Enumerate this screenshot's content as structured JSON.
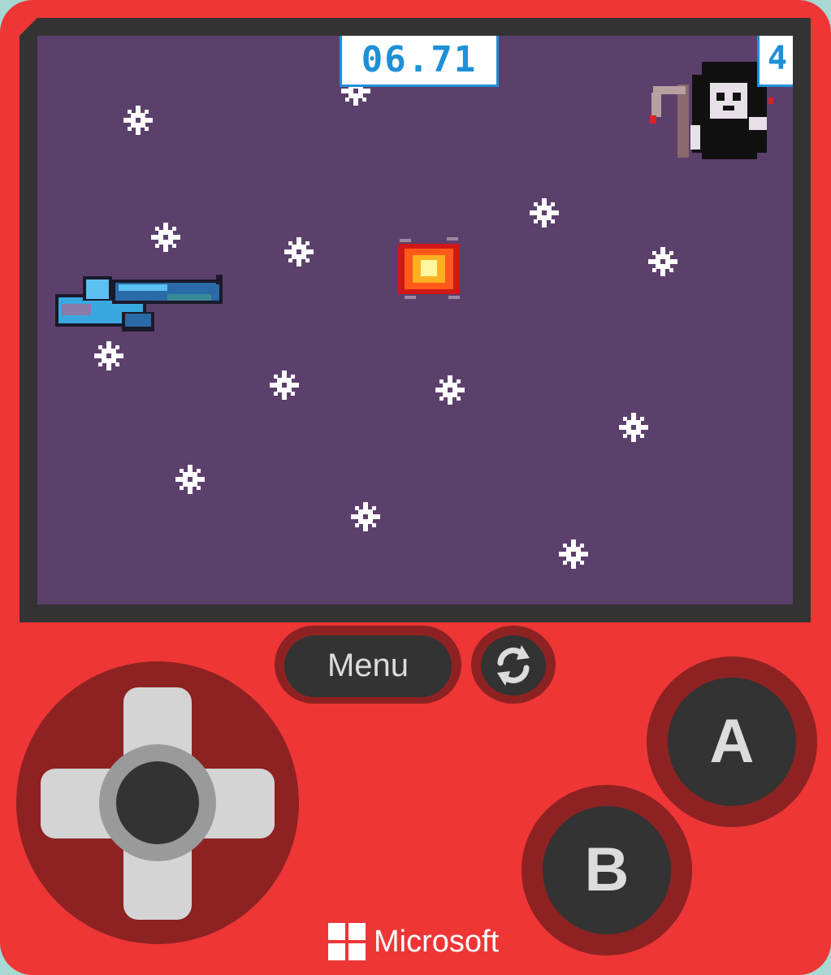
{
  "game": {
    "hud": {
      "timer": "06.71",
      "lives": "4"
    },
    "sprites": [
      "revolver",
      "fireball",
      "grim-reaper"
    ],
    "colors": {
      "screen_bg": "#5c406c",
      "hud_accent": "#1e90d8",
      "device_body": "#ee3636",
      "button_ring": "#8e2222",
      "button_face": "#333333"
    }
  },
  "controls": {
    "menu_label": "Menu",
    "reset_icon": "refresh-icon",
    "a_label": "A",
    "b_label": "B"
  },
  "brand": {
    "name": "Microsoft",
    "logo_icon": "microsoft-logo"
  }
}
